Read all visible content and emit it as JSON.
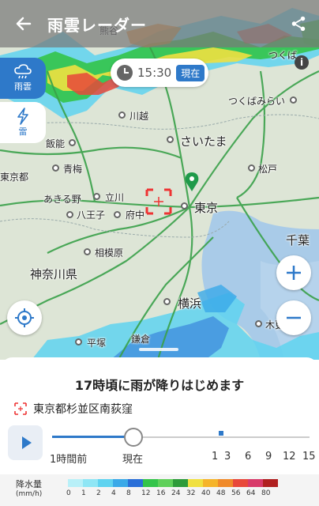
{
  "appbar": {
    "title": "雨雲レーダー",
    "back_icon": "back-arrow-icon",
    "share_icon": "share-icon"
  },
  "modes": [
    {
      "label": "雨雲",
      "icon": "cloud-rain-icon",
      "active": true
    },
    {
      "label": "雷",
      "icon": "lightning-icon",
      "active": false
    }
  ],
  "time": {
    "value": "15:30",
    "now_badge": "現在"
  },
  "places": {
    "kumagaya": "熊谷",
    "tsukuba": "つくば",
    "tsukubamirai": "つくばみらい",
    "kawagoe": "川越",
    "saitama": "さいたま",
    "hanno": "飯能",
    "tokyo_to": "東京都",
    "ome": "青梅",
    "matsudo": "松戸",
    "akiruno": "あきる野",
    "tachikawa": "立川",
    "hachioji": "八王子",
    "fuchu": "府中",
    "tokyo": "東京",
    "chiba": "千葉",
    "sagamihara": "相模原",
    "kanagawa": "神奈川県",
    "yokohama": "横浜",
    "kisarazu": "木更",
    "hiratsuka": "平塚",
    "kamakura": "鎌倉"
  },
  "sheet": {
    "forecast": "17時頃に雨が降りはじめます",
    "location": "東京都杉並区南荻窪",
    "play_icon": "play-icon",
    "timeline": {
      "labels": [
        "1時間前",
        "現在",
        "1",
        "3",
        "6",
        "9",
        "12",
        "15"
      ],
      "current_index": 1
    }
  },
  "legend": {
    "title": "降水量",
    "unit": "(mm/h)",
    "values": [
      "0",
      "1",
      "2",
      "4",
      "8",
      "12",
      "16",
      "24",
      "32",
      "40",
      "48",
      "56",
      "64",
      "80"
    ],
    "colors": [
      "#b8f0f8",
      "#8fe6f5",
      "#5fd3f0",
      "#3aa9e8",
      "#2a6fd8",
      "#33c44a",
      "#5fd05a",
      "#2e9b3a",
      "#f0e040",
      "#f5b42a",
      "#f08a2a",
      "#e8483a",
      "#d83a6a",
      "#b02020"
    ]
  }
}
